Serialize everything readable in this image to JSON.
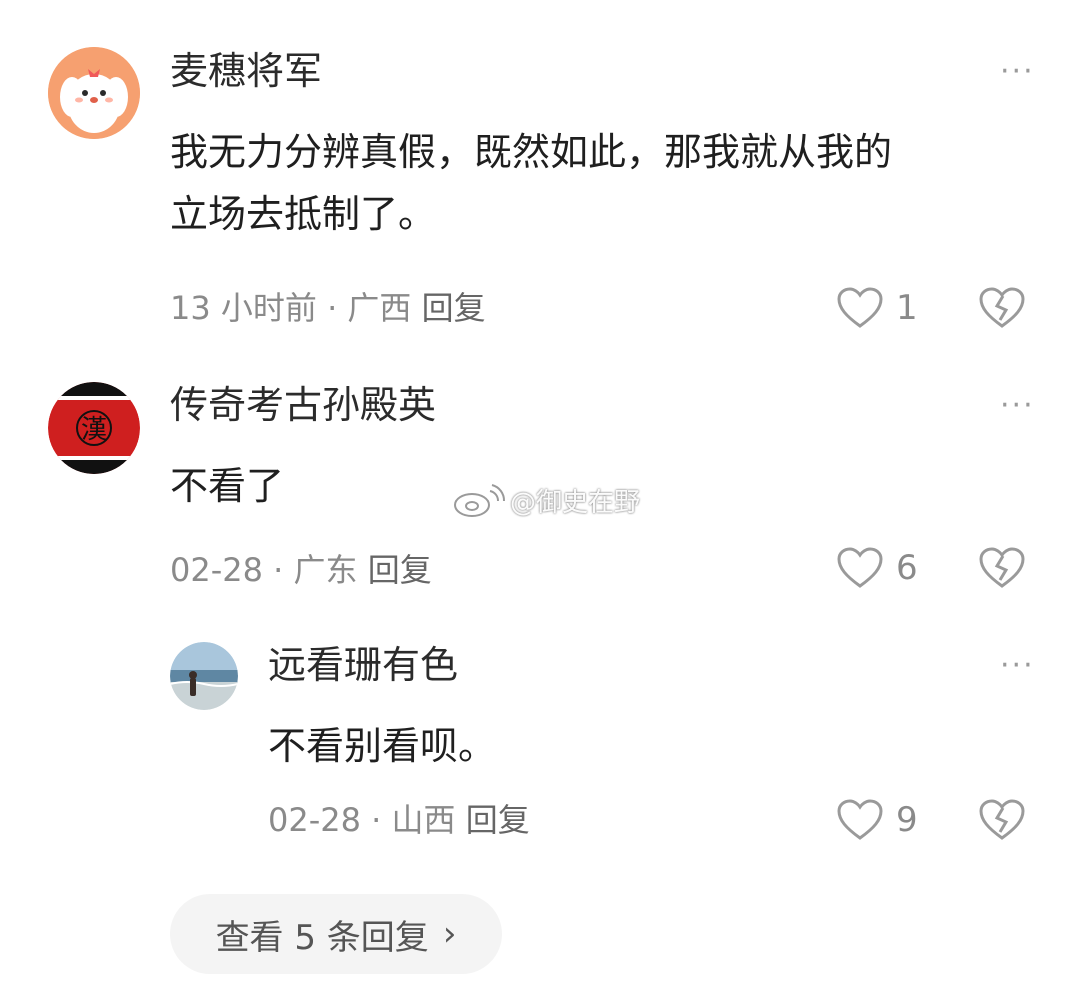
{
  "comments": [
    {
      "username": "麦穗将军",
      "content_line1": "我无力分辨真假，既然如此，那我就从我的",
      "content_line2": "立场去抵制了。",
      "time": "13 小时前",
      "location": "广西",
      "reply_label": "回复",
      "likes": "1"
    },
    {
      "username": "传奇考古孙殿英",
      "content": "不看了",
      "avatar_text": "漢",
      "time": "02-28",
      "location": "广东",
      "reply_label": "回复",
      "likes": "6"
    }
  ],
  "reply": {
    "username": "远看珊有色",
    "content": "不看别看呗。",
    "time": "02-28",
    "location": "山西",
    "reply_label": "回复",
    "likes": "9"
  },
  "meta_separator": "·",
  "more_label": "···",
  "watermark": "@御史在野",
  "view_more": {
    "label": "查看 5 条回复",
    "arrow": "›"
  },
  "colors": {
    "text": "#1f1f1f",
    "meta": "#8a8a8a",
    "icon": "#9a9a9a",
    "pill_bg": "#f4f4f4"
  }
}
